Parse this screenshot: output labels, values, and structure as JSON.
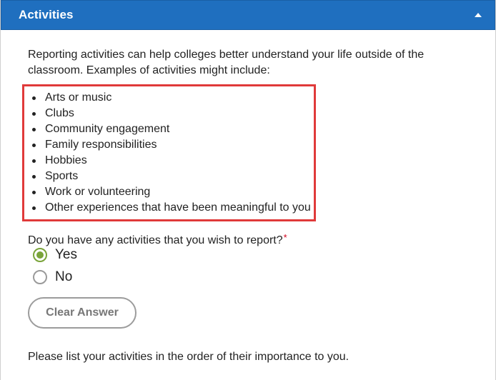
{
  "header": {
    "title": "Activities",
    "collapse_icon": "chevron-up-icon",
    "background": "#1f6fbf"
  },
  "intro": {
    "text": "Reporting activities can help colleges better understand your life outside of the classroom. Examples of activities might include:"
  },
  "examples": [
    "Arts or music",
    "Clubs",
    "Community engagement",
    "Family responsibilities",
    "Hobbies",
    "Sports",
    "Work or volunteering",
    "Other experiences that have been meaningful to you"
  ],
  "highlight_color": "#e03a3a",
  "question": {
    "text": "Do you have any activities that you wish to report?",
    "required_marker": "*"
  },
  "options": [
    {
      "label": "Yes",
      "selected": true
    },
    {
      "label": "No",
      "selected": false
    }
  ],
  "accent_color": "#7aa43a",
  "clear_button": {
    "label": "Clear Answer"
  },
  "footer": {
    "text": "Please list your activities in the order of their importance to you."
  }
}
